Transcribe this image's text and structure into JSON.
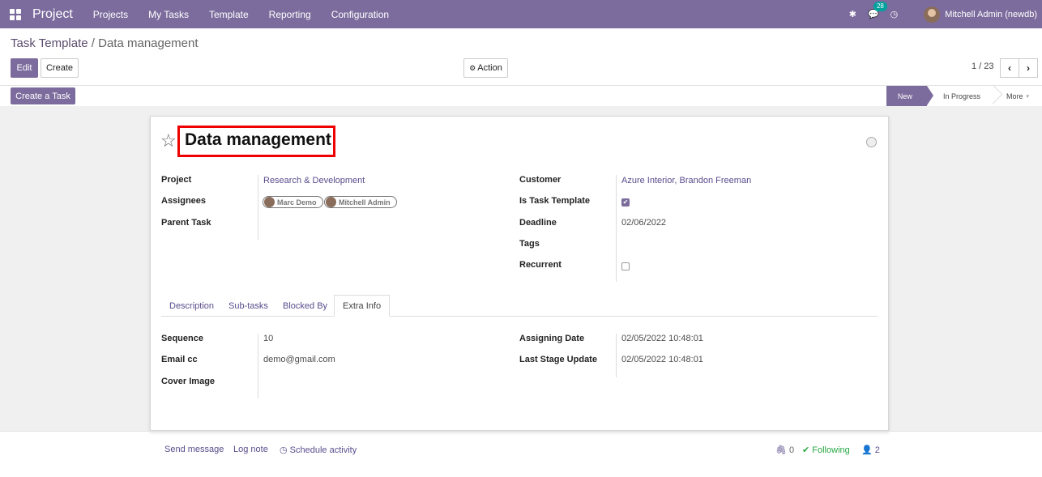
{
  "navbar": {
    "app_title": "Project",
    "menu": [
      "Projects",
      "My Tasks",
      "Template",
      "Reporting",
      "Configuration"
    ],
    "notif_count": "28",
    "user": "Mitchell Admin (newdb)"
  },
  "breadcrumb": {
    "parent": "Task Template",
    "separator": "/",
    "current": "Data management"
  },
  "toolbar": {
    "edit": "Edit",
    "create": "Create",
    "action": "Action",
    "pager": "1 / 23"
  },
  "header_buttons": {
    "create_task": "Create a Task"
  },
  "stages": [
    "New",
    "In Progress",
    "More"
  ],
  "record": {
    "title": "Data management",
    "left_fields": [
      {
        "label": "Project",
        "value": "Research & Development"
      },
      {
        "label": "Assignees"
      },
      {
        "label": "Parent Task"
      }
    ],
    "assignees": [
      "Marc Demo",
      "Mitchell Admin"
    ],
    "right_fields": [
      {
        "label": "Customer",
        "value": "Azure Interior, Brandon Freeman"
      },
      {
        "label": "Is Task Template"
      },
      {
        "label": "Deadline",
        "value": "02/06/2022"
      },
      {
        "label": "Tags"
      },
      {
        "label": "Recurrent"
      }
    ],
    "tabs": [
      "Description",
      "Sub-tasks",
      "Blocked By",
      "Extra Info"
    ],
    "extra_left": [
      {
        "label": "Sequence",
        "value": "10"
      },
      {
        "label": "Email cc",
        "value": "demo@gmail.com"
      },
      {
        "label": "Cover Image"
      }
    ],
    "extra_right": [
      {
        "label": "Assigning Date",
        "value": "02/05/2022 10:48:01"
      },
      {
        "label": "Last Stage Update",
        "value": "02/05/2022 10:48:01"
      }
    ]
  },
  "chatter": {
    "send_message": "Send message",
    "log_note": "Log note",
    "schedule_activity": "Schedule activity",
    "attachments": "0",
    "following": "Following",
    "followers": "2"
  }
}
